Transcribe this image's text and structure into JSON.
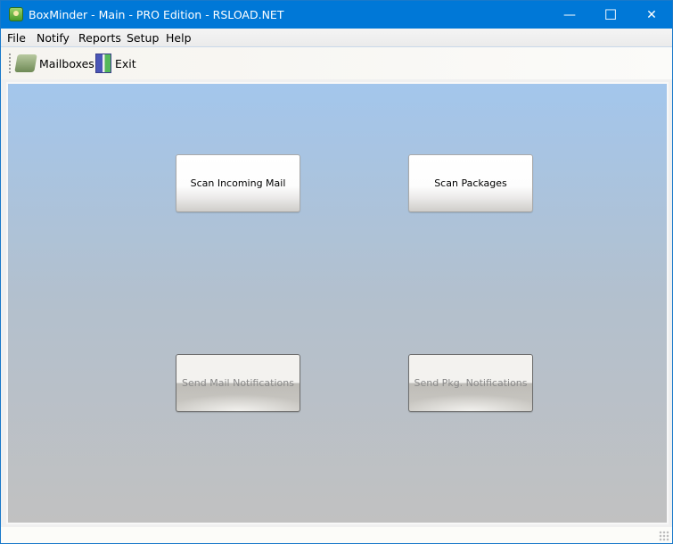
{
  "window": {
    "title": "BoxMinder - Main - PRO Edition - RSLOAD.NET",
    "minimize": "—",
    "maximize": "☐",
    "close": "✕"
  },
  "menu": [
    "File",
    "Notify",
    "Reports",
    "Setup",
    "Help"
  ],
  "toolbar": {
    "mailboxes": "Mailboxes",
    "exit": "Exit"
  },
  "buttons": {
    "scan_mail": "Scan Incoming Mail",
    "scan_packages": "Scan Packages",
    "send_mail": "Send Mail Notifications",
    "send_pkg": "Send Pkg. Notifications"
  },
  "icons": {
    "app": "boxminder-app-icon",
    "mailboxes": "mailbox-icon",
    "exit": "exit-door-icon"
  }
}
